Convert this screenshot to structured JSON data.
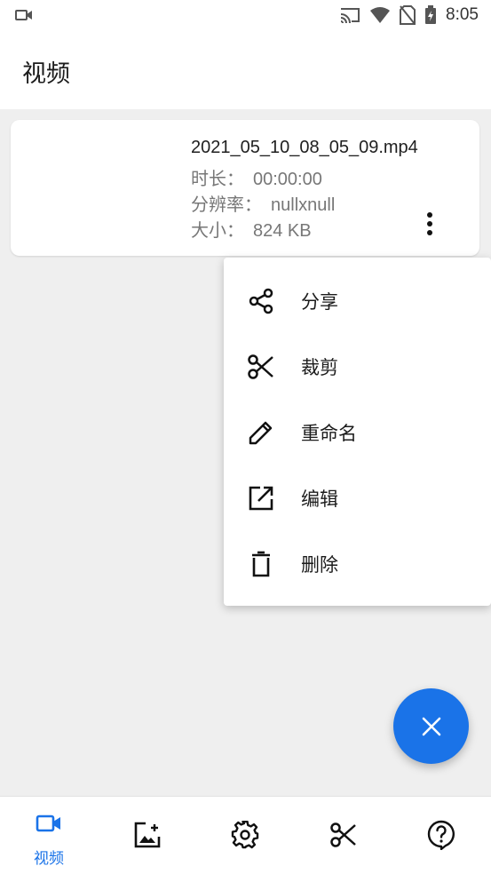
{
  "status_bar": {
    "time": "8:05"
  },
  "app_bar": {
    "title": "视频"
  },
  "video_card": {
    "file_name": "2021_05_10_08_05_09.mp4",
    "duration_label": "时长：",
    "duration_value": "00:00:00",
    "resolution_label": "分辨率：",
    "resolution_value": "nullxnull",
    "size_label": "大小：",
    "size_value": "824 KB"
  },
  "popup_menu": {
    "items": [
      {
        "label": "分享",
        "icon": "share-icon"
      },
      {
        "label": "裁剪",
        "icon": "scissors-icon"
      },
      {
        "label": "重命名",
        "icon": "pencil-icon"
      },
      {
        "label": "编辑",
        "icon": "open-external-icon"
      },
      {
        "label": "删除",
        "icon": "trash-icon"
      }
    ]
  },
  "fab": {
    "icon": "close-icon"
  },
  "bottom_nav": {
    "items": [
      {
        "label": "视频",
        "icon": "video-camera-icon",
        "active": true
      },
      {
        "icon": "image-icon"
      },
      {
        "icon": "settings-gear-icon"
      },
      {
        "icon": "scissors-icon"
      },
      {
        "icon": "help-icon"
      }
    ]
  },
  "colors": {
    "accent": "#1a73e8",
    "background": "#efefef",
    "surface": "#ffffff",
    "secondary_text": "#777777"
  }
}
